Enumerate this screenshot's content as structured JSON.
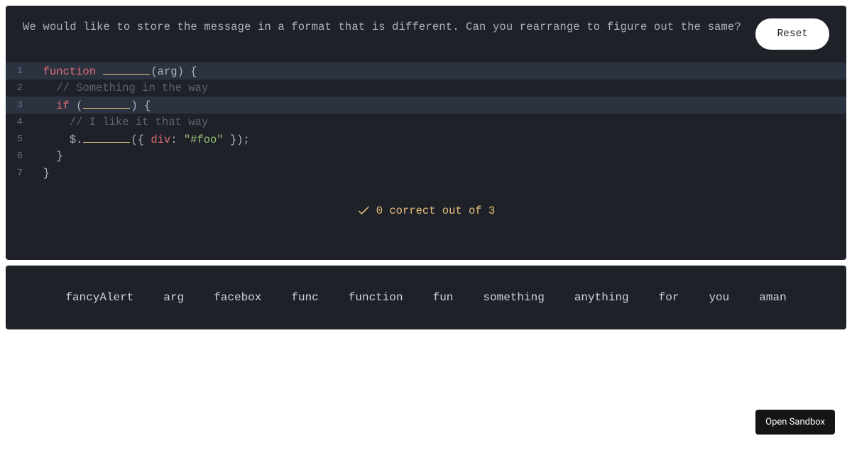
{
  "header": {
    "prompt": "We would like to store the message in a format that is different. Can you rearrange to figure out the same?",
    "reset_label": "Reset"
  },
  "editor": {
    "lines": [
      "1",
      "2",
      "3",
      "4",
      "5",
      "6",
      "7"
    ],
    "line1": {
      "kw": "function",
      "paren_open": "(",
      "arg": "arg",
      "paren_close": ")",
      "brace": " {"
    },
    "line2": {
      "comment": "// Something in the way"
    },
    "line3": {
      "kw": "if",
      "paren_open": " (",
      "paren_close": ")",
      "brace": " {"
    },
    "line4": {
      "comment": "// I like it that way"
    },
    "line5": {
      "dollar": "$.",
      "args_open": "({ ",
      "attr": "div",
      "colon": ": ",
      "str": "\"#foo\"",
      "args_close": " });"
    },
    "line6": {
      "brace": "}"
    },
    "line7": {
      "brace": "}"
    }
  },
  "progress": {
    "text": "0 correct out of 3"
  },
  "bank": {
    "words": [
      "fancyAlert",
      "arg",
      "facebox",
      "func",
      "function",
      "fun",
      "something",
      "anything",
      "for",
      "you",
      "aman"
    ]
  },
  "footer": {
    "sandbox_label": "Open Sandbox"
  }
}
